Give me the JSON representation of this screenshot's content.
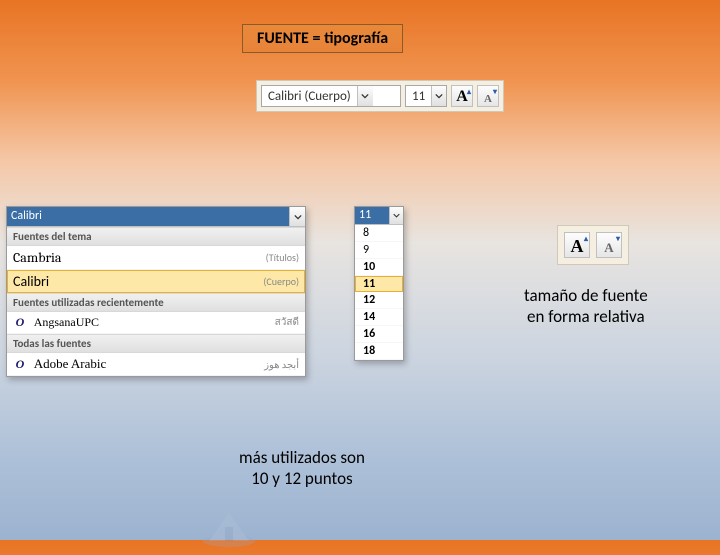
{
  "title": "FUENTE = tipografía",
  "ribbon": {
    "font_name": "Calibri (Cuerpo)",
    "font_size": "11",
    "grow_label": "A",
    "shrink_label": "A"
  },
  "font_dropdown": {
    "selected": "Calibri",
    "sections": {
      "theme_header": "Fuentes del tema",
      "theme_fonts": [
        {
          "name": "Cambria",
          "hint": "(Títulos)"
        },
        {
          "name": "Calibri",
          "hint": "(Cuerpo)"
        }
      ],
      "recent_header": "Fuentes utilizadas recientemente",
      "recent_fonts": [
        {
          "name": "AngsanaUPC",
          "sample": "สวัสดี"
        }
      ],
      "all_header": "Todas las fuentes",
      "all_fonts": [
        {
          "name": "Adobe Arabic",
          "sample": "أبجد هوز"
        }
      ]
    }
  },
  "size_dropdown": {
    "selected": "11",
    "options": [
      "8",
      "9",
      "10",
      "11",
      "12",
      "14",
      "16",
      "18"
    ],
    "highlight": "11",
    "bold_from_index": 2
  },
  "labels": {
    "relative": "tamaño de fuente\nen forma relativa",
    "common": "más utilizados son\n10 y 12 puntos"
  },
  "icons": {
    "dropdown": "chevron-down",
    "grow": "grow-font",
    "shrink": "shrink-font",
    "otfont": "O"
  }
}
